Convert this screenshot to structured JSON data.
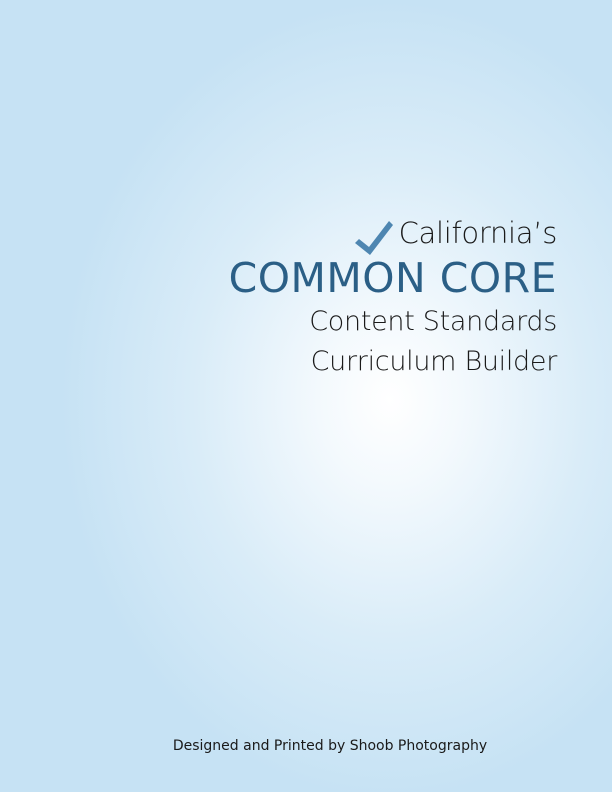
{
  "cover": {
    "line1": "California’s",
    "headline_part1": "COMMO",
    "headline_part2": "N CORE",
    "line3": "Content Standards",
    "line4": "Curriculum Builder",
    "footer": "Designed and Printed by Shoob Photography"
  },
  "colors": {
    "headline": "#2b5f86",
    "checkmark": "#3d7aa8",
    "background_center": "#ffffff",
    "background_edge": "#c6e2f4"
  },
  "icons": {
    "checkmark": "check-mark-icon"
  }
}
